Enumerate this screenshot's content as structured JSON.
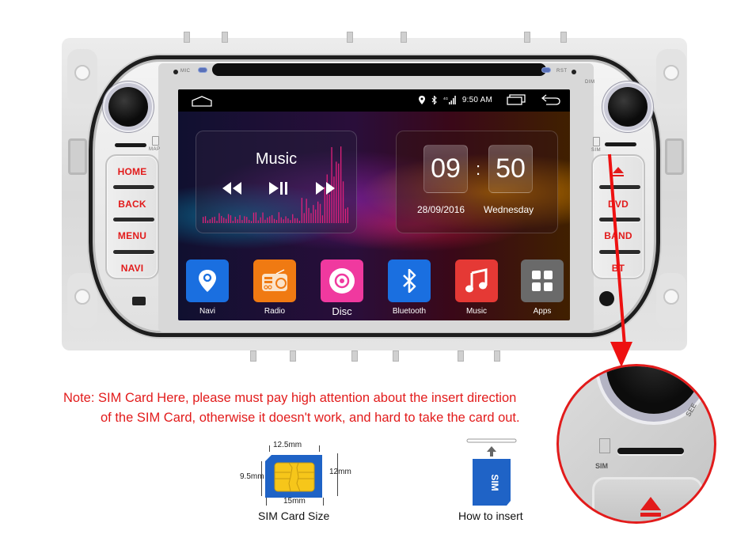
{
  "device": {
    "top_labels": {
      "mic": "MIC",
      "rst": "RST",
      "dim": "DIM",
      "map": "MAP",
      "sim": "SIM"
    },
    "left_buttons": [
      "HOME",
      "BACK",
      "MENU",
      "NAVI"
    ],
    "right_buttons": [
      "eject",
      "DVD",
      "BAND",
      "BT"
    ],
    "accent_red": "#e21b1b"
  },
  "screen": {
    "statusbar": {
      "time": "9:50 AM",
      "icons": [
        "home-icon",
        "location-icon",
        "bluetooth-icon",
        "signal-4g-icon",
        "recent-apps-icon",
        "back-icon"
      ]
    },
    "music_widget": {
      "title": "Music",
      "controls": [
        "previous",
        "play-pause",
        "next"
      ]
    },
    "clock_widget": {
      "hours": "09",
      "separator": ":",
      "minutes": "50",
      "date": "28/09/2016",
      "weekday": "Wednesday"
    },
    "apps": [
      {
        "label": "Navi",
        "icon": "map-pin-icon",
        "color": "#1a6fe0"
      },
      {
        "label": "Radio",
        "icon": "radio-icon",
        "color": "#f07a12"
      },
      {
        "label": "Disc",
        "icon": "disc-icon",
        "color": "#f0399f"
      },
      {
        "label": "Bluetooth",
        "icon": "bluetooth-icon",
        "color": "#1a6fe0"
      },
      {
        "label": "Music",
        "icon": "music-note-icon",
        "color": "#e53935"
      },
      {
        "label": "Apps",
        "icon": "apps-grid-icon",
        "color": "#6a6a6a"
      }
    ]
  },
  "callout": {
    "sim_label": "SIM",
    "seek_label": "SEE"
  },
  "note": {
    "line1": "Note: SIM Card Here, please must pay high attention about the insert direction",
    "line2": "of the SIM Card, otherwise it doesn't work, and hard to take the card out."
  },
  "sim_size": {
    "top": "12.5mm",
    "left": "9.5mm",
    "right": "12mm",
    "bottom": "15mm",
    "caption": "SIM Card Size"
  },
  "how_to_insert": {
    "card_text": "SIM",
    "caption": "How to insert"
  }
}
